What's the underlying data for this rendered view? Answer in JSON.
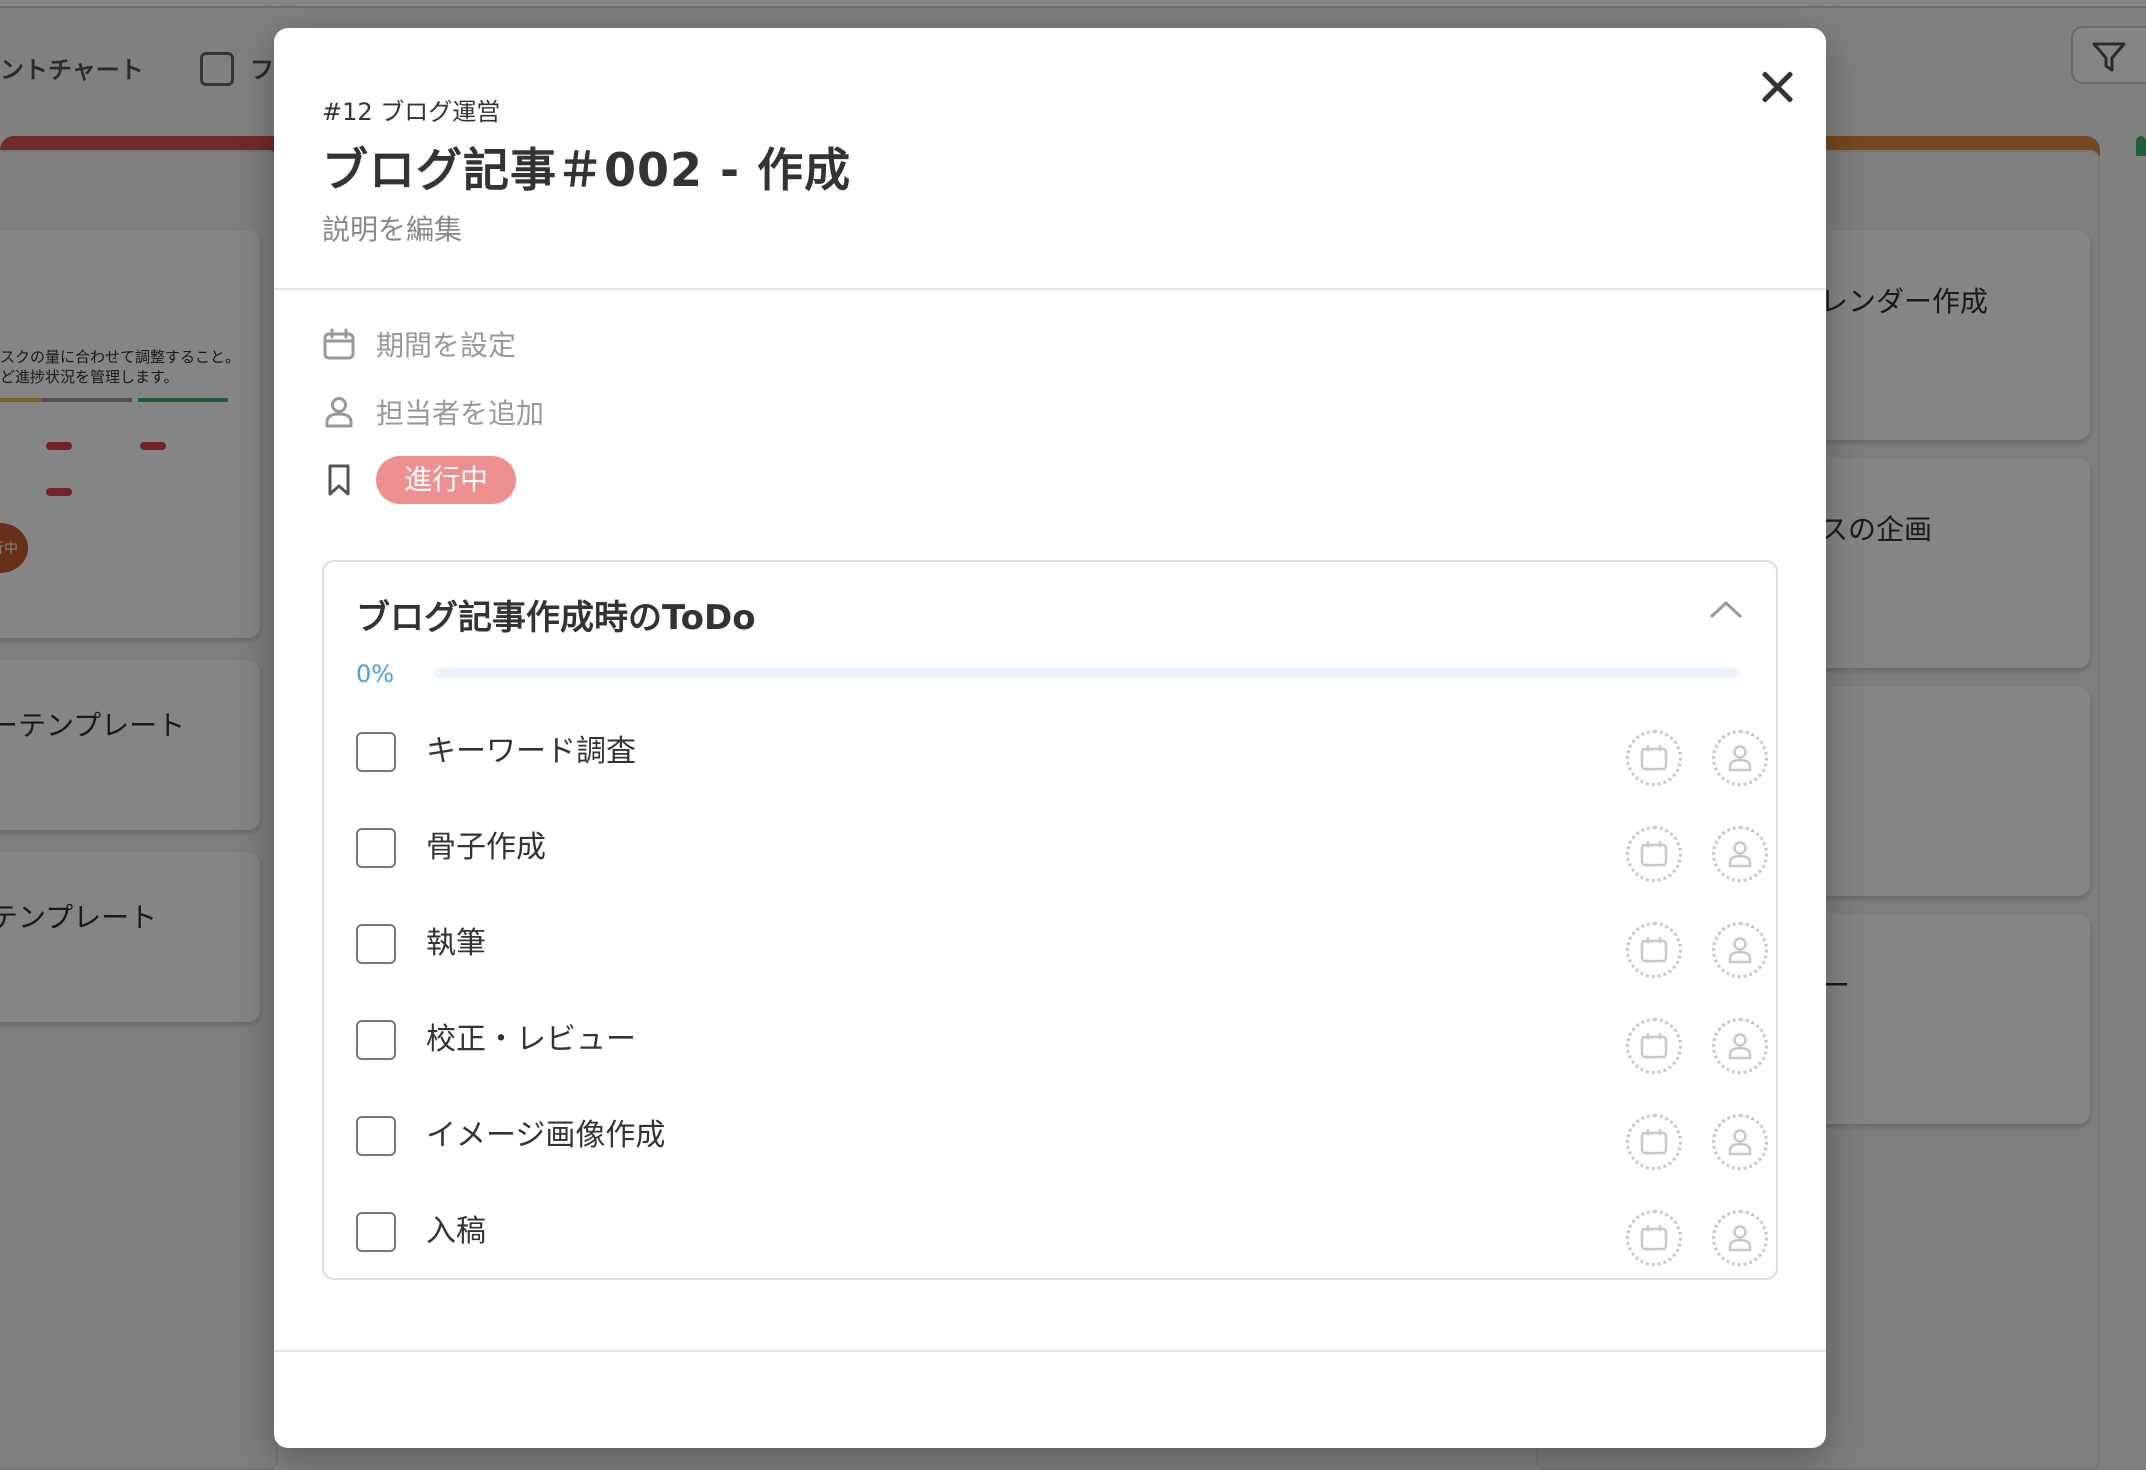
{
  "background": {
    "toolbar": {
      "gantt_label": "ントチャート",
      "second_label": "フ"
    },
    "cards": {
      "left_template_1": "ーテンプレート",
      "left_template_2": "テンプレート",
      "thumb_line_1": "スクの量に合わせて調整すること。",
      "thumb_line_2": "ど進捗状況を管理します。",
      "thumb_badge": "行中",
      "right_card_1": "レンダー作成",
      "right_card_2": "スの企画",
      "right_card_3": "ー"
    }
  },
  "modal": {
    "project_label": "#12 ブログ運営",
    "title": "ブログ記事＃002 - 作成",
    "description_link": "説明を編集",
    "meta": {
      "period_label": "期間を設定",
      "assignee_label": "担当者を追加",
      "status_label": "進行中"
    },
    "checklist": {
      "title": "ブログ記事作成時のToDo",
      "percent_text": "0%",
      "progress": 0,
      "items": [
        {
          "label": "キーワード調査",
          "checked": false
        },
        {
          "label": "骨子作成",
          "checked": false
        },
        {
          "label": "執筆",
          "checked": false
        },
        {
          "label": "校正・レビュー",
          "checked": false
        },
        {
          "label": "イメージ画像作成",
          "checked": false
        },
        {
          "label": "入稿",
          "checked": false
        }
      ]
    },
    "icons": {
      "close": "close-icon",
      "period": "calendar-icon",
      "assignee": "person-icon",
      "status": "bookmark-icon",
      "collapse": "chevron-up-icon"
    }
  },
  "colors": {
    "status_badge": "#ef8f8f",
    "progress_accent": "#4a9fe0",
    "column_red": "#d9534f",
    "column_orange": "#e08a3c",
    "column_green": "#3cb371"
  }
}
